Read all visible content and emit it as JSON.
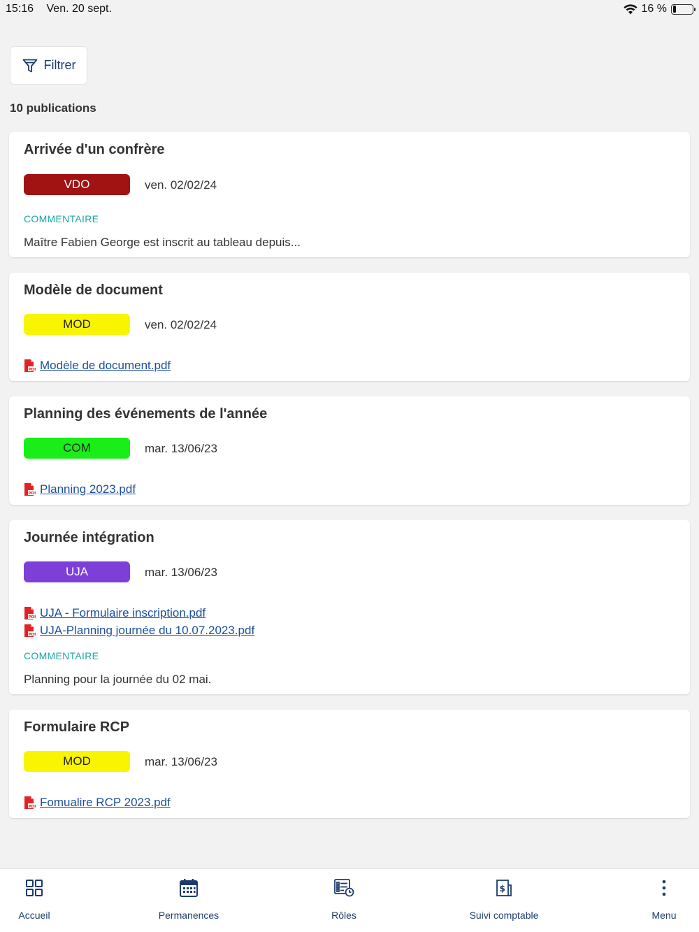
{
  "status_bar": {
    "time": "15:16",
    "date": "Ven. 20 sept.",
    "battery_text": "16 %",
    "battery_level": 0.16
  },
  "filter": {
    "label": "Filtrer",
    "icon": "filter-icon"
  },
  "publications_count": "10 publications",
  "colors": {
    "VDO": "#a11313",
    "MOD": "#f9f500",
    "COM": "#19ee19",
    "UJA": "#7d3fd8",
    "accent": "#1c3b6e",
    "comment_label": "#1fa6a6",
    "link": "#1c4f9c"
  },
  "cards": [
    {
      "title": "Arrivée d'un confrère",
      "tag": "VDO",
      "date": "ven. 02/02/24",
      "comment_label": "COMMENTAIRE",
      "comment": "Maître Fabien George est inscrit au tableau depuis..."
    },
    {
      "title": "Modèle de document",
      "tag": "MOD",
      "date": "ven. 02/02/24",
      "attachments": [
        "Modèle de document.pdf"
      ]
    },
    {
      "title": "Planning des événements de l'année",
      "tag": "COM",
      "date": "mar. 13/06/23",
      "attachments": [
        "Planning 2023.pdf"
      ]
    },
    {
      "title": "Journée intégration",
      "tag": "UJA",
      "date": "mar. 13/06/23",
      "attachments": [
        "UJA - Formulaire inscription.pdf",
        "UJA-Planning journée du 10.07.2023.pdf"
      ],
      "comment_label": "COMMENTAIRE",
      "comment": "Planning pour la journée du 02 mai."
    },
    {
      "title": "Formulaire RCP",
      "tag": "MOD",
      "date": "mar. 13/06/23",
      "attachments": [
        "Fomualire RCP 2023.pdf"
      ]
    }
  ],
  "pdf_icon": "pdf-file-icon",
  "bottom_nav": [
    {
      "label": "Accueil",
      "icon": "grid-icon"
    },
    {
      "label": "Permanences",
      "icon": "calendar-icon"
    },
    {
      "label": "Rôles",
      "icon": "roles-list-icon"
    },
    {
      "label": "Suivi comptable",
      "icon": "accounting-icon"
    },
    {
      "label": "Menu",
      "icon": "more-vertical-icon"
    }
  ]
}
